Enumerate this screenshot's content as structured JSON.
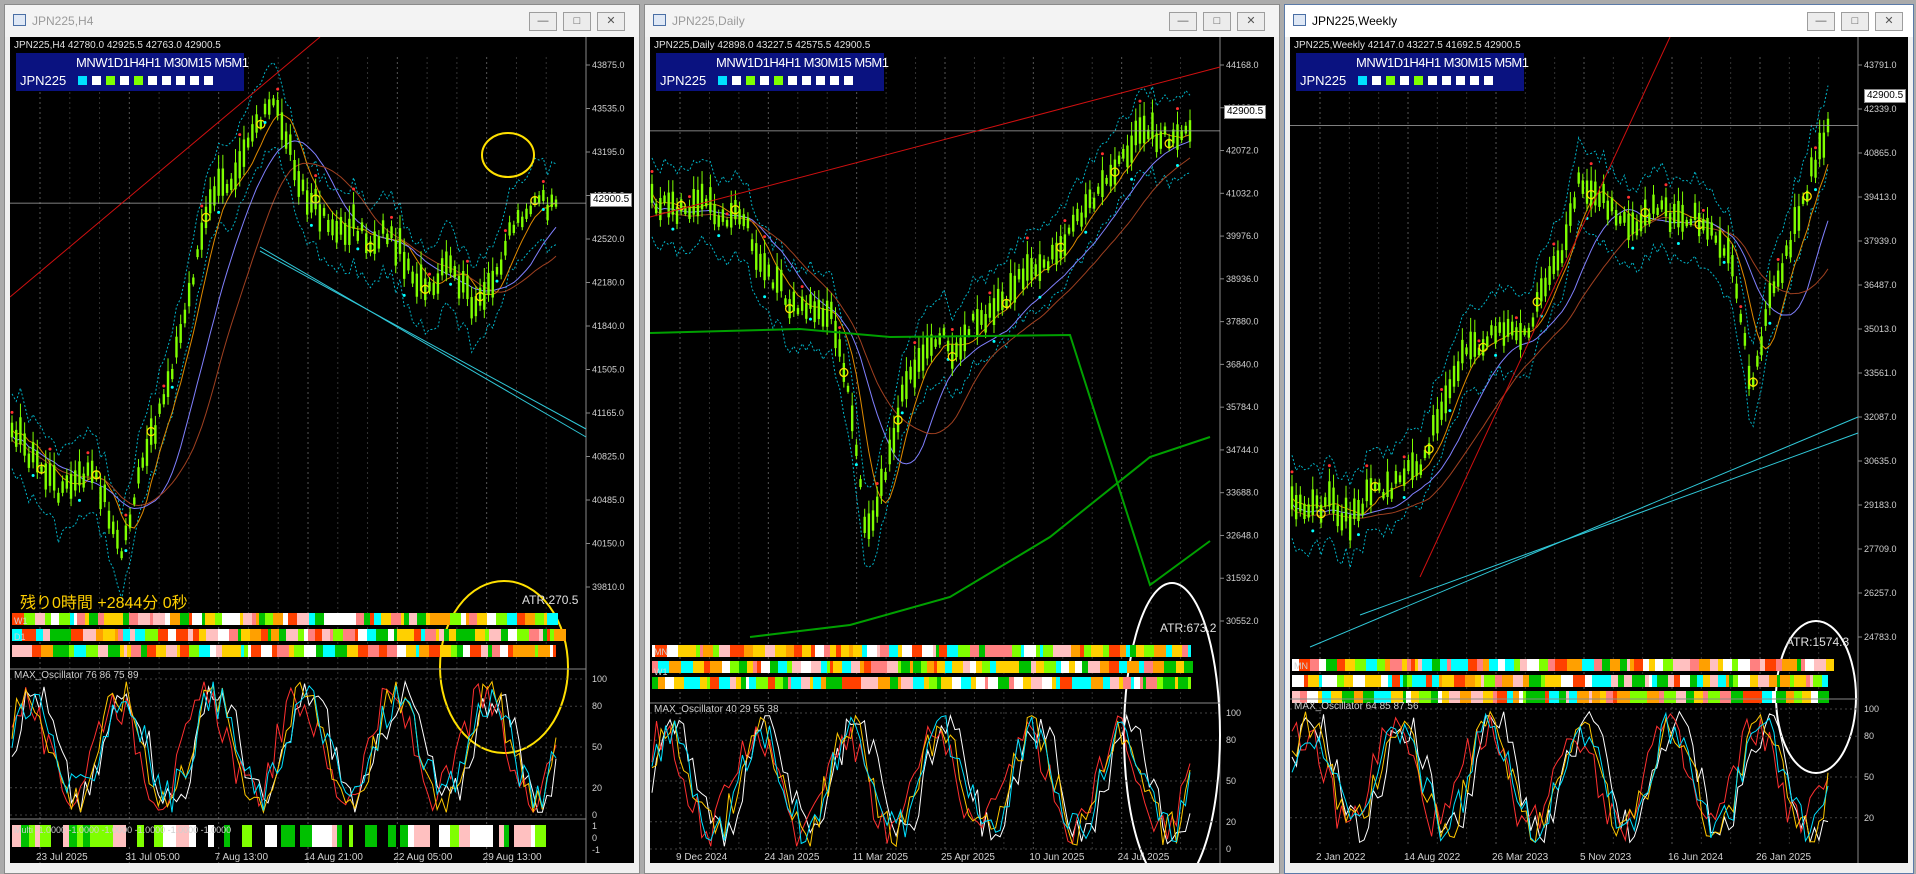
{
  "windows": [
    {
      "id": "h4",
      "title": "JPN225,H4",
      "header": "JPN225,H4  42780.0 42925.5 42763.0 42900.5",
      "symbol": "JPN225",
      "timeframes": "MNW1D1H4H1 M30M15 M5M1",
      "price_tag": "42900.5",
      "price_axis": [
        "43875.0",
        "43535.0",
        "43195.0",
        "42860.0",
        "42520.0",
        "42180.0",
        "41840.0",
        "41505.0",
        "41165.0",
        "40825.0",
        "40485.0",
        "40150.0",
        "39810.0"
      ],
      "dates": [
        "23 Jul 2025",
        "31 Jul 05:00",
        "7 Aug 13:00",
        "14 Aug 21:00",
        "22 Aug 05:00",
        "29 Aug 13:00"
      ],
      "timer": "残り0時間 +2844分 0秒",
      "atr": "ATR:270.5",
      "band_labels": [
        "W1",
        "D1"
      ],
      "oscillator_label": "MAX_Oscillator 76 86 75 89",
      "oscillator_levels": [
        "100",
        "80",
        "50",
        "20",
        "0"
      ],
      "multi_label": "Multi -1.0000 -1.0000 -1.0000 -1.0000 -1.0000 -1.0000",
      "multi_levels": [
        "1",
        "0",
        "-1"
      ],
      "color": "#ffe000"
    },
    {
      "id": "daily",
      "title": "JPN225,Daily",
      "header": "JPN225,Daily  42898.0 43227.5 42575.5 42900.5",
      "symbol": "JPN225",
      "timeframes": "MNW1D1H4H1 M30M15 M5M1",
      "price_tag": "42900.5",
      "price_axis": [
        "44168.0",
        "43128.0",
        "42072.0",
        "41032.0",
        "39976.0",
        "38936.0",
        "37880.0",
        "36840.0",
        "35784.0",
        "34744.0",
        "33688.0",
        "32648.0",
        "31592.0",
        "30552.0"
      ],
      "dates": [
        "9 Dec 2024",
        "24 Jan 2025",
        "11 Mar 2025",
        "25 Apr 2025",
        "10 Jun 2025",
        "24 Jul 2025"
      ],
      "atr": "ATR:673.2",
      "band_labels": [
        "MN",
        "W1"
      ],
      "oscillator_label": "MAX_Oscillator 40 29 55 38",
      "oscillator_levels": [
        "100",
        "80",
        "50",
        "20",
        "0"
      ],
      "color": "#ffffff"
    },
    {
      "id": "weekly",
      "title": "JPN225,Weekly",
      "header": "JPN225,Weekly  42147.0 43227.5 41692.5 42900.5",
      "symbol": "JPN225",
      "timeframes": "MNW1D1H4H1 M30M15 M5M1",
      "price_tag": "42900.5",
      "price_axis": [
        "43791.0",
        "42339.0",
        "40865.0",
        "39413.0",
        "37939.0",
        "36487.0",
        "35013.0",
        "33561.0",
        "32087.0",
        "30635.0",
        "29183.0",
        "27709.0",
        "26257.0",
        "24783.0"
      ],
      "dates": [
        "2 Jan 2022",
        "14 Aug 2022",
        "26 Mar 2023",
        "5 Nov 2023",
        "16 Jun 2024",
        "26 Jan 2025"
      ],
      "atr": "ATR:1574.3",
      "band_labels": [
        "MN"
      ],
      "oscillator_label": "MAX_Oscillator 64 85 87 56",
      "oscillator_levels": [
        "100",
        "80",
        "50",
        "20"
      ],
      "color": "#ffffff"
    }
  ],
  "window_buttons": {
    "minimize": "—",
    "maximize": "□",
    "close": "✕"
  },
  "colors": {
    "candle": "#7fff00",
    "upper_band": "#00b4c8",
    "trend_red": "#d01010",
    "trend_cyan": "#30c8d8",
    "circle_yellow": "#ffe000",
    "ma_green": "#00a000",
    "osc_white": "#ffffff",
    "osc_cyan": "#00e0ff",
    "osc_yellow": "#ffc800",
    "osc_red": "#ff3030"
  }
}
